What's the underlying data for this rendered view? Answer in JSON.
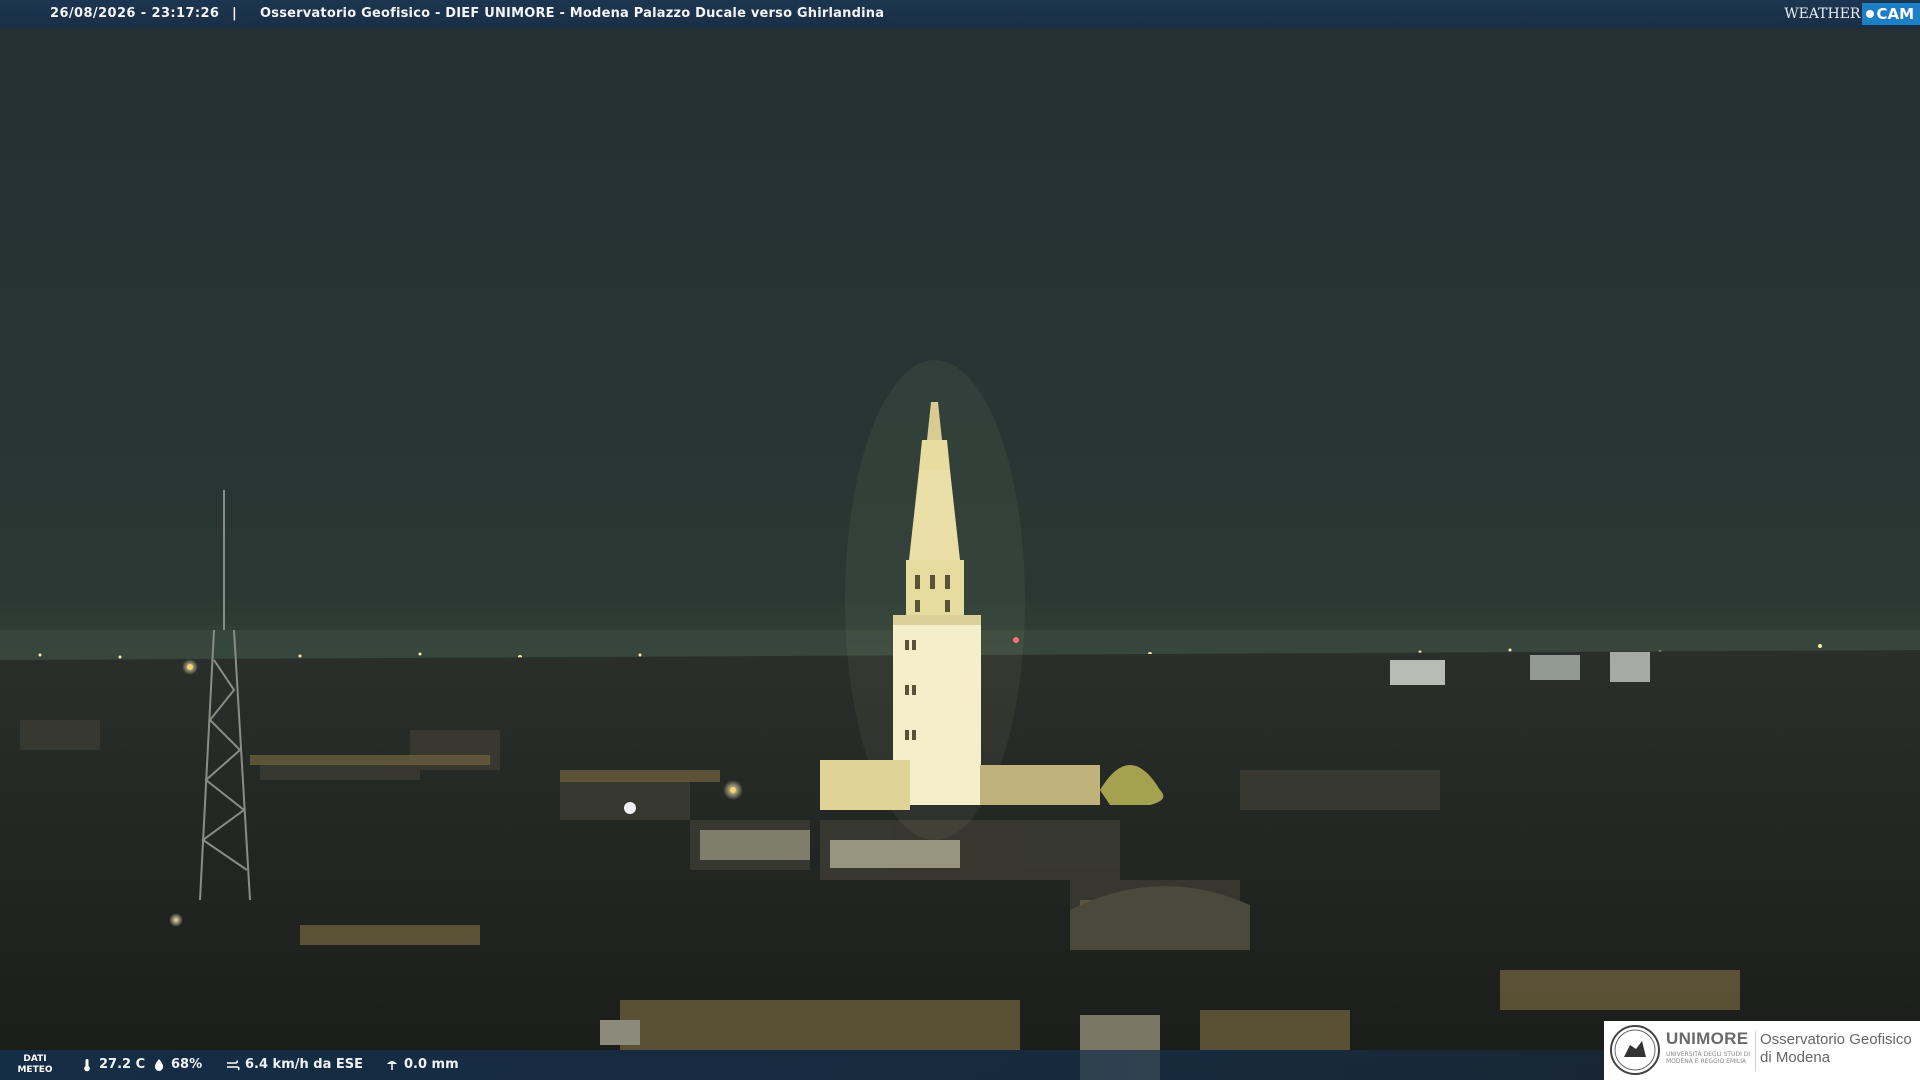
{
  "header": {
    "timestamp": "26/08/2026 - 23:17:26",
    "separator": "|",
    "title": "Osservatorio Geofisico - DIEF UNIMORE - Modena Palazzo Ducale verso Ghirlandina",
    "brand_weather": "WEATHER",
    "brand_cam": "CAM"
  },
  "meteo": {
    "tag_line1": "DATI",
    "tag_line2": "METEO",
    "temperature": "27.2 C",
    "humidity": "68%",
    "wind": "6.4 km/h da ESE",
    "rain": "0.0 mm",
    "icons": [
      "thermometer-icon",
      "humidity-drop-icon",
      "wind-icon",
      "rain-gauge-icon"
    ]
  },
  "logo": {
    "university": "UNIMORE",
    "university_small": "UNIVERSITÀ DEGLI STUDI DI MODENA E REGGIO EMILIA",
    "observatory_line1": "Osservatorio Geofisico",
    "observatory_line2": "di Modena"
  },
  "colors": {
    "sky": "#27342f",
    "tower_light": "#f3e9b8",
    "city_lights": "#f6d26b",
    "bar": "#1b3149",
    "brand_blue": "#1d7fc4",
    "unimore_orange": "#e2621f"
  }
}
